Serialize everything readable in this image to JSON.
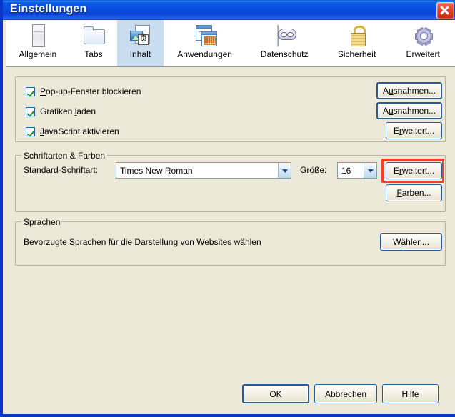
{
  "window": {
    "title": "Einstellungen",
    "close_label": "Schließen",
    "titlebar_color": "#0b4fe0",
    "frame_color": "#0a36c8",
    "content_bg": "#ece9d8"
  },
  "tabs": [
    {
      "label": "Allgemein",
      "icon": "window-icon",
      "selected": false
    },
    {
      "label": "Tabs",
      "icon": "folder-icon",
      "selected": false
    },
    {
      "label": "Inhalt",
      "icon": "content-page-icon",
      "selected": true
    },
    {
      "label": "Anwendungen",
      "icon": "applications-icon",
      "selected": false
    },
    {
      "label": "Datenschutz",
      "icon": "mask-icon",
      "selected": false
    },
    {
      "label": "Sicherheit",
      "icon": "lock-icon",
      "selected": false
    },
    {
      "label": "Erweitert",
      "icon": "gear-icon",
      "selected": false
    }
  ],
  "content": {
    "checkbox_group": {
      "items": [
        {
          "label_pre": "",
          "accel": "P",
          "label_post": "op-up-Fenster blockieren",
          "checked": true,
          "button": {
            "pre": "A",
            "accel": "u",
            "post": "snahmen...",
            "default": true
          }
        },
        {
          "label_pre": "Grafiken ",
          "accel": "l",
          "label_post": "aden",
          "checked": true,
          "button": {
            "pre": "A",
            "accel": "u",
            "post": "snahmen...",
            "default": true
          }
        },
        {
          "label_pre": "",
          "accel": "J",
          "label_post": "avaScript aktivieren",
          "checked": true,
          "button": {
            "pre": "E",
            "accel": "r",
            "post": "weitert...",
            "default": false
          }
        }
      ]
    },
    "fonts_group": {
      "legend": "Schriftarten & Farben",
      "font_label_pre": "",
      "font_label_accel": "S",
      "font_label_post": "tandard-Schriftart:",
      "font_value": "Times New Roman",
      "size_label_pre": "",
      "size_label_accel": "G",
      "size_label_post": "röße:",
      "size_value": "16",
      "advanced_button": {
        "pre": "E",
        "accel": "r",
        "post": "weitert...",
        "highlighted": true
      },
      "colors_button": {
        "pre": "",
        "accel": "F",
        "post": "arben..."
      },
      "highlight_color": "#f4402a"
    },
    "languages_group": {
      "legend": "Sprachen",
      "description": "Bevorzugte Sprachen für die Darstellung von Websites wählen",
      "choose_button": {
        "pre": "W",
        "accel": "ä",
        "post": "hlen..."
      }
    }
  },
  "footer": {
    "ok": {
      "label": "OK",
      "default": true
    },
    "cancel": {
      "label": "Abbrechen"
    },
    "help": {
      "pre": "H",
      "accel": "i",
      "post": "lfe"
    }
  }
}
